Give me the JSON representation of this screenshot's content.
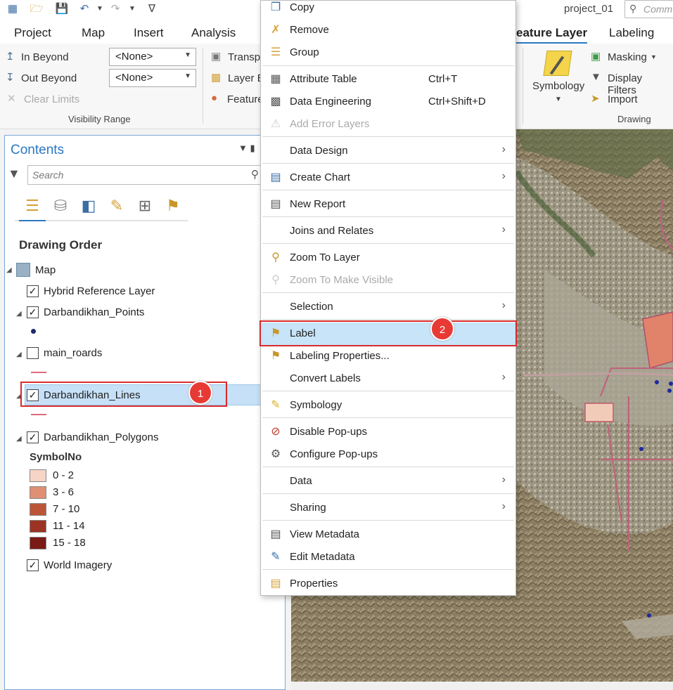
{
  "app": {
    "title": "project_01",
    "command_search_placeholder": "Comm"
  },
  "quick_access": [
    "new-project-icon",
    "open-icon",
    "save-icon",
    "undo-icon",
    "dropdown-icon",
    "redo-icon",
    "dropdown-icon",
    "customize-icon"
  ],
  "tabs": [
    "Project",
    "Map",
    "Insert",
    "Analysis",
    "eature Layer",
    "Labeling"
  ],
  "ribbon": {
    "in_beyond": "In Beyond",
    "out_beyond": "Out Beyond",
    "clear_limits": "Clear Limits",
    "in_beyond_value": "<None>",
    "out_beyond_value": "<None>",
    "visibility_range": "Visibility Range",
    "transparency": "Transpa",
    "layer_blend": "Layer B",
    "features": "Feature",
    "symbology": "Symbology",
    "masking": "Masking",
    "display_filters": "Display Filters",
    "import": "Import",
    "drawing": "Drawing"
  },
  "contents": {
    "title": "Contents",
    "search_placeholder": "Search",
    "drawing_order": "Drawing Order",
    "map": "Map",
    "layers": {
      "hybrid": "Hybrid Reference Layer",
      "points": "Darbandikhan_Points",
      "roads": "main_roards",
      "lines": "Darbandikhan_Lines",
      "polygons": "Darbandikhan_Polygons",
      "symbol_field": "SymbolNo",
      "world_imagery": "World Imagery"
    },
    "legend": [
      {
        "label": "0 - 2",
        "color": "#f6d5c6"
      },
      {
        "label": "3 - 6",
        "color": "#de8f74"
      },
      {
        "label": "7 - 10",
        "color": "#bc5538"
      },
      {
        "label": "11 - 14",
        "color": "#9b3422"
      },
      {
        "label": "15 - 18",
        "color": "#7a1a14"
      }
    ]
  },
  "context_menu": {
    "copy": "Copy",
    "remove": "Remove",
    "group": "Group",
    "attribute_table": "Attribute Table",
    "attribute_table_shortcut": "Ctrl+T",
    "data_engineering": "Data Engineering",
    "data_engineering_shortcut": "Ctrl+Shift+D",
    "add_error_layers": "Add Error Layers",
    "data_design": "Data Design",
    "create_chart": "Create Chart",
    "new_report": "New Report",
    "joins_relates": "Joins and Relates",
    "zoom_to_layer": "Zoom To Layer",
    "zoom_visible": "Zoom To Make Visible",
    "selection": "Selection",
    "label": "Label",
    "labeling_properties": "Labeling Properties...",
    "convert_labels": "Convert Labels",
    "symbology": "Symbology",
    "disable_popups": "Disable Pop-ups",
    "configure_popups": "Configure Pop-ups",
    "data": "Data",
    "sharing": "Sharing",
    "view_metadata": "View Metadata",
    "edit_metadata": "Edit Metadata",
    "properties": "Properties"
  },
  "callouts": [
    "1",
    "2"
  ],
  "colors": {
    "accent": "#2b78c2",
    "callout": "#d92b2b",
    "highlight": "#c7e4f8"
  }
}
